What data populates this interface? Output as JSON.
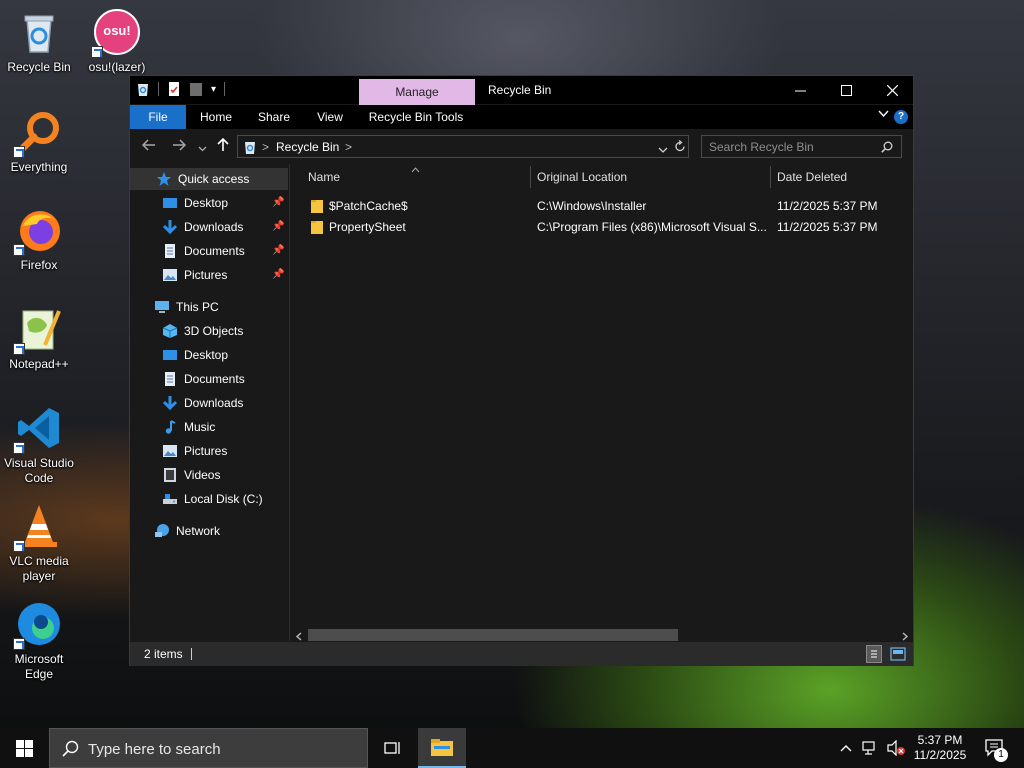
{
  "desktop": {
    "icons": [
      {
        "label": "Recycle Bin",
        "icon": "recycle-bin-icon"
      },
      {
        "label": "osu!(lazer)",
        "icon": "osu-icon",
        "badge_text": "osu!"
      },
      {
        "label": "Everything",
        "icon": "everything-search-icon"
      },
      {
        "label": "Firefox",
        "icon": "firefox-icon"
      },
      {
        "label": "Notepad++",
        "icon": "notepad-plus-plus-icon"
      },
      {
        "label": "Visual Studio Code",
        "icon": "vscode-icon"
      },
      {
        "label": "VLC media player",
        "icon": "vlc-icon"
      },
      {
        "label": "Microsoft Edge",
        "icon": "edge-icon"
      }
    ]
  },
  "window": {
    "title": "Recycle Bin",
    "manage_tab": "Manage",
    "ribbon_tabs": [
      "File",
      "Home",
      "Share",
      "View",
      "Recycle Bin Tools"
    ],
    "address": {
      "root_chevron": ">",
      "crumb": "Recycle Bin",
      "trail_chevron": ">"
    },
    "search": {
      "placeholder": "Search Recycle Bin"
    },
    "nav": {
      "quick_access": "Quick access",
      "quick_items": [
        "Desktop",
        "Downloads",
        "Documents",
        "Pictures"
      ],
      "this_pc": "This PC",
      "pc_items": [
        "3D Objects",
        "Desktop",
        "Documents",
        "Downloads",
        "Music",
        "Pictures",
        "Videos",
        "Local Disk (C:)"
      ],
      "network": "Network"
    },
    "columns": [
      "Name",
      "Original Location",
      "Date Deleted"
    ],
    "files": [
      {
        "name": "$PatchCache$",
        "location": "C:\\Windows\\Installer",
        "date": "11/2/2025 5:37 PM"
      },
      {
        "name": "PropertySheet",
        "location": "C:\\Program Files (x86)\\Microsoft Visual S...",
        "date": "11/2/2025 5:37 PM"
      }
    ],
    "status": {
      "count": "2 items"
    }
  },
  "taskbar": {
    "search_placeholder": "Type here to search",
    "time": "5:37 PM",
    "date": "11/2/2025",
    "notification_count": "1"
  },
  "colors": {
    "accent": "#1a6fc9",
    "manage_tab": "#e2b8e6",
    "folder": "#f5c542"
  }
}
